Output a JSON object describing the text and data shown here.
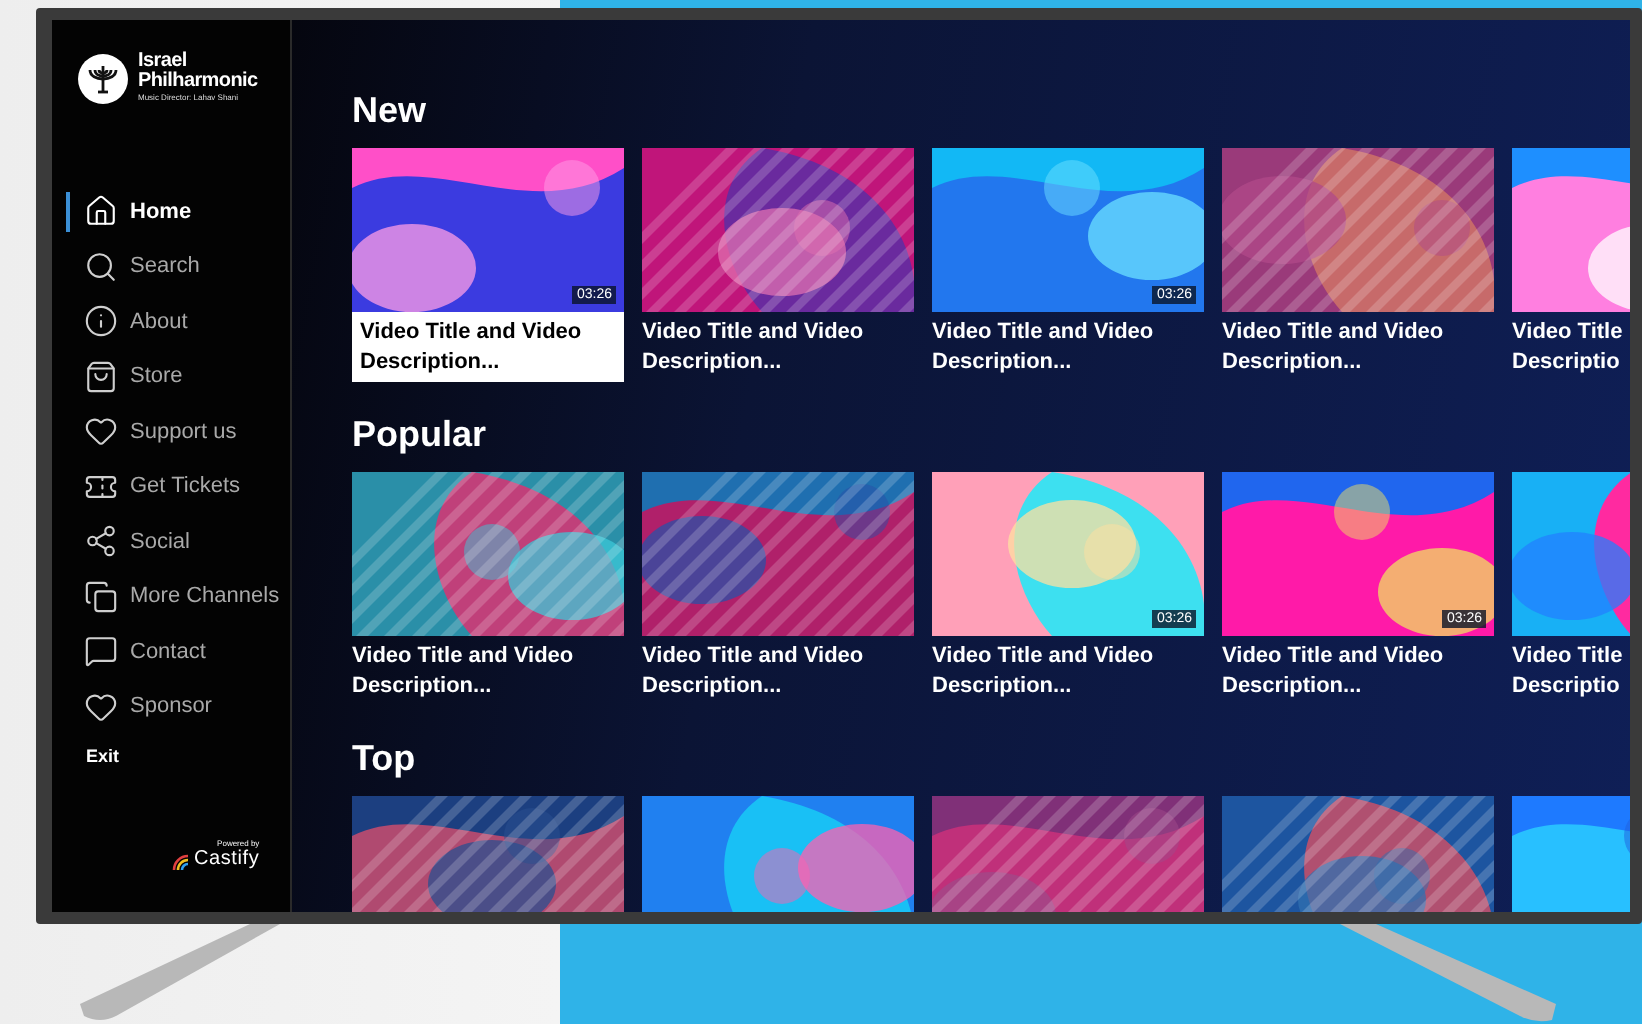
{
  "logo": {
    "name_lines": [
      "Israel",
      "Philharmonic"
    ],
    "subtitle": "Music Director: Lahav Shani"
  },
  "nav": [
    {
      "label": "Home",
      "selected": true
    },
    {
      "label": "Search",
      "selected": false
    },
    {
      "label": "About",
      "selected": false
    },
    {
      "label": "Store",
      "selected": false
    },
    {
      "label": "Support us",
      "selected": false
    },
    {
      "label": "Get Tickets",
      "selected": false
    },
    {
      "label": "Social",
      "selected": false
    },
    {
      "label": "More Channels",
      "selected": false
    },
    {
      "label": "Contact",
      "selected": false
    },
    {
      "label": "Sponsor",
      "selected": false
    }
  ],
  "exit": "Exit",
  "powered": {
    "caption": "Powered by",
    "brand": "Castify"
  },
  "sections": [
    {
      "title": "New",
      "items": [
        {
          "kind": "picture",
          "selected": true,
          "duration": "03:26",
          "caption": [
            "Video Title and Video",
            "Description..."
          ]
        },
        {
          "kind": "picture",
          "selected": false,
          "caption": [
            "Video Title and Video",
            "Description..."
          ]
        },
        {
          "kind": "picture",
          "selected": false,
          "duration": "03:26",
          "caption": [
            "Video Title and Video",
            "Description..."
          ]
        },
        {
          "kind": "picture",
          "selected": false,
          "caption": [
            "Video Title and Video",
            "Description..."
          ]
        },
        {
          "kind": "picture",
          "selected": false,
          "caption": [
            "Video Title",
            "Descriptio"
          ]
        }
      ]
    },
    {
      "title": "Popular",
      "items": [
        {
          "kind": "picture",
          "selected": false,
          "caption": [
            "Video Title and Video",
            "Description..."
          ]
        },
        {
          "kind": "picture",
          "selected": false,
          "caption": [
            "Video Title and Video",
            "Description..."
          ]
        },
        {
          "kind": "picture",
          "selected": false,
          "duration": "03:26",
          "caption": [
            "Video Title and Video",
            "Description..."
          ]
        },
        {
          "kind": "picture",
          "selected": false,
          "duration": "03:26",
          "caption": [
            "Video Title and Video",
            "Description..."
          ]
        },
        {
          "kind": "picture",
          "selected": false,
          "caption": [
            "Video Title",
            "Descriptio"
          ]
        }
      ]
    },
    {
      "title": "Top"
    }
  ]
}
